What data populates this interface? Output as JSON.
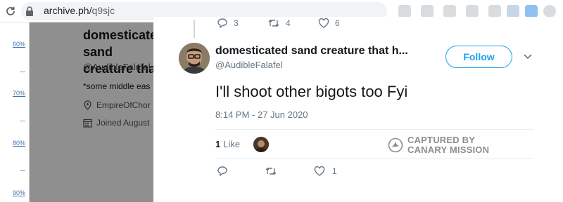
{
  "browser": {
    "url_host": "archive.ph/",
    "url_path": "q9sjc"
  },
  "gutter": {
    "marks": [
      "60%",
      "70%",
      "80%",
      "90%"
    ]
  },
  "background_profile": {
    "name": "domesticated sand creature tha",
    "handle": "@AudibleFalafel",
    "bio": "*some middle eas",
    "location": "EmpireOfChor",
    "joined": "Joined August"
  },
  "previous_tweet_actions": {
    "replies": "3",
    "retweets": "4",
    "likes": "6"
  },
  "tweet": {
    "author_name": "domesticated sand creature that h...",
    "author_handle": "@AudibleFalafel",
    "follow_label": "Follow",
    "text": "I'll shoot other bigots too Fyi",
    "date": "8:14 PM - 27 Jun 2020",
    "likes_count": "1",
    "likes_label": "Like",
    "actions": {
      "likes": "1"
    }
  },
  "watermark": {
    "line1": "CAPTURED BY",
    "line2": "CANARY MISSION"
  },
  "colors": {
    "accent": "#1da1f2",
    "secondary_text": "#657786",
    "overlay": "#8f8f8f"
  }
}
